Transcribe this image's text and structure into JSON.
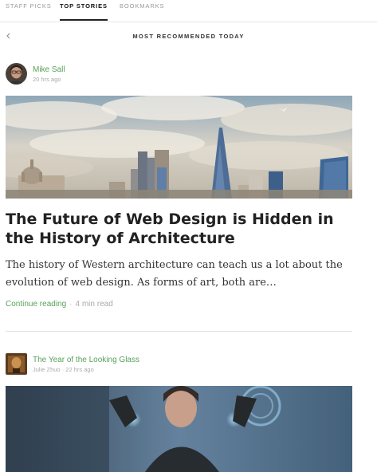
{
  "tabs": [
    {
      "label": "Staff Picks"
    },
    {
      "label": "Top Stories"
    },
    {
      "label": "Bookmarks"
    }
  ],
  "header": {
    "title": "MOST RECOMMENDED TODAY",
    "back_icon": "chevron-left-icon"
  },
  "posts": [
    {
      "author": "Mike Sall",
      "time": "20 hrs ago",
      "title": "The Future of Web Design is Hidden in the History of Architecture",
      "excerpt": "The history of Western architecture can teach us a lot about the evolution of web design. As forms of art, both are…",
      "continue_label": "Continue reading",
      "separator": "·",
      "read_time": "4 min read"
    },
    {
      "title": "The Year of the Looking Glass",
      "author": "Julie Zhuo",
      "separator": "·",
      "time": "22 hrs ago"
    }
  ],
  "colors": {
    "accent": "#5aa05a",
    "text": "#222222",
    "muted": "#aaaaaa"
  }
}
